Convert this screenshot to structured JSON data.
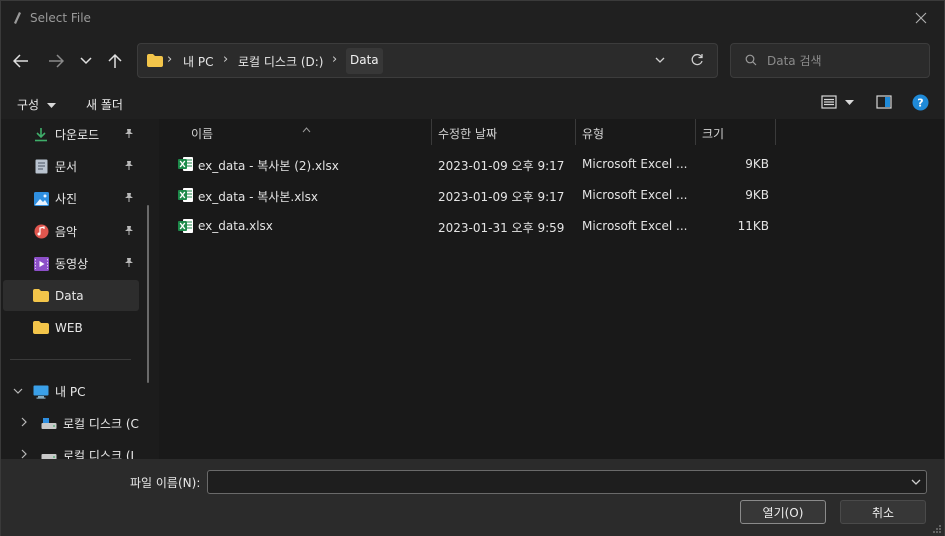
{
  "window": {
    "title": "Select File"
  },
  "nav": {
    "breadcrumbs": [
      "내 PC",
      "로컬 디스크 (D:)",
      "Data"
    ]
  },
  "search": {
    "placeholder": "Data 검색"
  },
  "toolbar": {
    "organize_label": "구성",
    "new_folder_label": "새 폴더"
  },
  "sidebar": {
    "items": [
      {
        "label": "다운로드",
        "icon": "download-icon",
        "pinned": true
      },
      {
        "label": "문서",
        "icon": "document-icon",
        "pinned": true
      },
      {
        "label": "사진",
        "icon": "pictures-icon",
        "pinned": true
      },
      {
        "label": "음악",
        "icon": "music-icon",
        "pinned": true
      },
      {
        "label": "동영상",
        "icon": "video-icon",
        "pinned": true
      },
      {
        "label": "Data",
        "icon": "folder-icon",
        "selected": true
      },
      {
        "label": "WEB",
        "icon": "folder-icon"
      },
      {
        "label": "내 PC",
        "icon": "pc-icon"
      },
      {
        "label": "로컬 디스크 (C",
        "icon": "drive-icon"
      },
      {
        "label": "로컬 디스크 (I",
        "icon": "drive-icon"
      }
    ]
  },
  "columns": {
    "name": "이름",
    "modified": "수정한 날짜",
    "type": "유형",
    "size": "크기"
  },
  "files": [
    {
      "name": "ex_data - 복사본 (2).xlsx",
      "modified": "2023-01-09 오후 9:17",
      "type": "Microsoft Excel ...",
      "size": "9KB"
    },
    {
      "name": "ex_data - 복사본.xlsx",
      "modified": "2023-01-09 오후 9:17",
      "type": "Microsoft Excel ...",
      "size": "9KB"
    },
    {
      "name": "ex_data.xlsx",
      "modified": "2023-01-31 오후 9:59",
      "type": "Microsoft Excel ...",
      "size": "11KB"
    }
  ],
  "footer": {
    "filename_label": "파일 이름(N):",
    "filename_value": "",
    "open_label": "열기(O)",
    "cancel_label": "취소"
  },
  "colors": {
    "background": "#1c1c1c",
    "excel_green": "#1d8a4a",
    "folder_yellow": "#f3c54a",
    "help_blue": "#1f8ad8"
  }
}
